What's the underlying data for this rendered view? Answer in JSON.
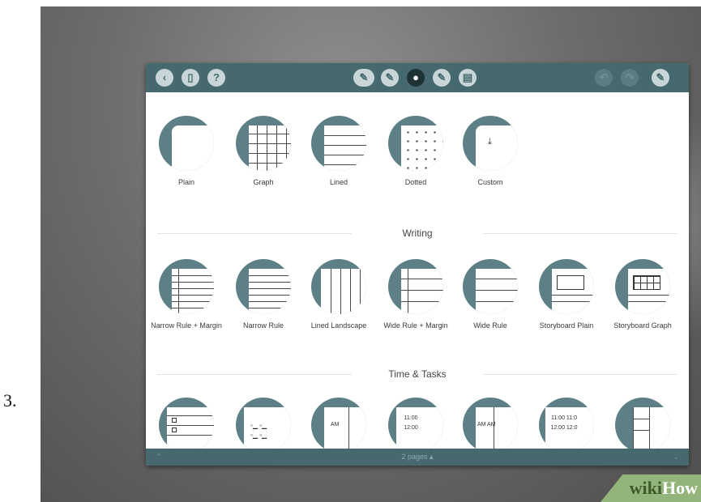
{
  "step_number": "3.",
  "watermark": {
    "part1": "wiki",
    "part2": "How"
  },
  "toolbar": {
    "left_icons": [
      "back-icon",
      "pages-icon",
      "help-icon"
    ],
    "center_icons": [
      "pen-tools-icon",
      "pen-icon",
      "ink-drop-icon",
      "highlighter-icon",
      "notebook-icon"
    ],
    "right_icons": [
      "undo-icon",
      "redo-icon",
      "pen-settings-icon"
    ]
  },
  "paper_types": [
    {
      "label": "Plain"
    },
    {
      "label": "Graph"
    },
    {
      "label": "Lined"
    },
    {
      "label": "Dotted"
    },
    {
      "label": "Custom"
    }
  ],
  "writing": {
    "title": "Writing",
    "items": [
      {
        "label": "Narrow Rule + Margin"
      },
      {
        "label": "Narrow Rule"
      },
      {
        "label": "Lined Landscape"
      },
      {
        "label": "Wide Rule + Margin"
      },
      {
        "label": "Wide Rule"
      },
      {
        "label": "Storyboard Plain"
      },
      {
        "label": "Storyboard Graph"
      }
    ]
  },
  "time_tasks": {
    "title": "Time & Tasks",
    "items": [
      {
        "text": ""
      },
      {
        "text": ""
      },
      {
        "text": "AM"
      },
      {
        "text": "11:00 12:00"
      },
      {
        "text": "AM AM"
      },
      {
        "text": "11:00 11:0 12:00 12:0"
      },
      {
        "text": ""
      }
    ]
  },
  "footer": {
    "page_label": "2 pages ▴"
  },
  "colors": {
    "accent": "#466970",
    "circle": "#5d7f86",
    "watermark": "#93b57b"
  }
}
